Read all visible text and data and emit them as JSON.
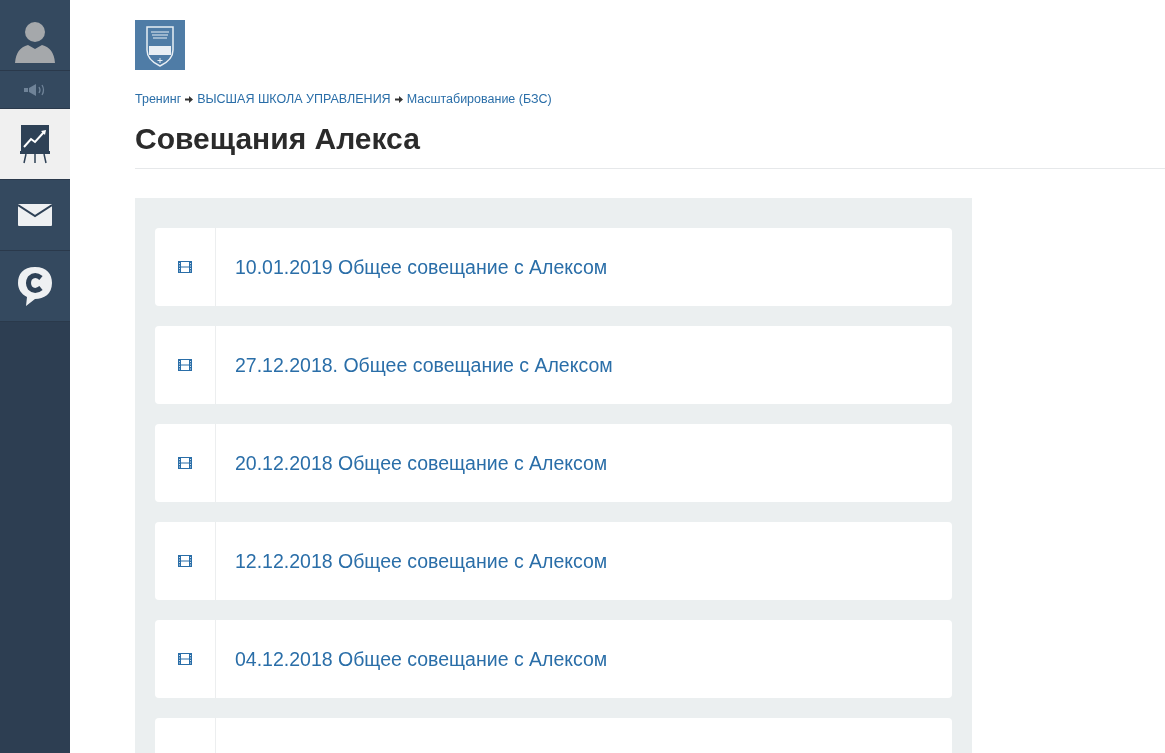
{
  "sidebar": {
    "items": [
      {
        "kind": "avatar",
        "selected": false
      },
      {
        "kind": "sound",
        "selected": false
      },
      {
        "kind": "chart",
        "selected": true
      },
      {
        "kind": "mail",
        "selected": false
      },
      {
        "kind": "chat",
        "selected": false
      }
    ]
  },
  "breadcrumbs": [
    {
      "label": "Тренинг"
    },
    {
      "label": "ВЫСШАЯ ШКОЛА УПРАВЛЕНИЯ"
    },
    {
      "label": "Масштабирование (БЗС)"
    }
  ],
  "title": "Совещания Алекса",
  "lessons": [
    {
      "kind": "video",
      "title": "10.01.2019 Общее совещание с Алексом"
    },
    {
      "kind": "video",
      "title": "27.12.2018. Общее совещание с Алексом"
    },
    {
      "kind": "video",
      "title": "20.12.2018 Общее совещание с Алексом"
    },
    {
      "kind": "video",
      "title": "12.12.2018 Общее совещание с Алексом"
    },
    {
      "kind": "video",
      "title": "04.12.2018 Общее совещание с Алексом"
    },
    {
      "kind": "blank"
    }
  ]
}
